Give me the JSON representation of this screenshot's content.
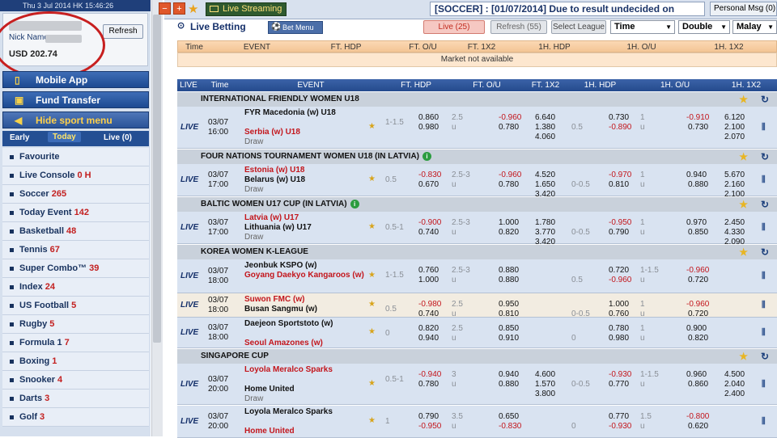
{
  "topbar": {
    "datetime": "Thu 3 Jul 2014  HK 15:46:26"
  },
  "account": {
    "nick_label": "Nick Name",
    "balance": "USD 202.74",
    "refresh": "Refresh"
  },
  "sidebar_buttons": {
    "mobile": "Mobile App",
    "fund": "Fund Transfer",
    "hide": "Hide sport menu"
  },
  "day_tabs": {
    "early": "Early",
    "today": "Today",
    "live": "Live (0)"
  },
  "sports": [
    {
      "name": "Favourite",
      "count": ""
    },
    {
      "name": "Live Console",
      "count": "0 H"
    },
    {
      "name": "Soccer",
      "count": "265"
    },
    {
      "name": "Today Event",
      "count": "142"
    },
    {
      "name": "Basketball",
      "count": "48"
    },
    {
      "name": "Tennis",
      "count": "67"
    },
    {
      "name": "Super Combo™",
      "count": "39"
    },
    {
      "name": "Index",
      "count": "24"
    },
    {
      "name": "US Football",
      "count": "5"
    },
    {
      "name": "Rugby",
      "count": "5"
    },
    {
      "name": "Formula 1",
      "count": "7"
    },
    {
      "name": "Boxing",
      "count": "1"
    },
    {
      "name": "Snooker",
      "count": "4"
    },
    {
      "name": "Darts",
      "count": "3"
    },
    {
      "name": "Golf",
      "count": "3"
    }
  ],
  "toolbar": {
    "live_streaming": "Live Streaming",
    "marquee": "[SOCCER] : [01/07/2014] Due to result undecided on",
    "personal_msg": "Personal Msg (0)"
  },
  "live_betting": {
    "title": "Live Betting",
    "bet_menu": "Bet Menu",
    "live_count": "Live (25)",
    "refresh_count": "Refresh (55)",
    "select_league": "Select League",
    "sort": "Time",
    "odds_type": "Double",
    "odds_format": "Malay"
  },
  "table1": {
    "headers": [
      "Time",
      "EVENT",
      "FT. HDP",
      "FT. O/U",
      "FT. 1X2",
      "1H. HDP",
      "1H. O/U",
      "1H. 1X2"
    ],
    "message": "Market not available"
  },
  "table2_headers": [
    "LIVE",
    "Time",
    "EVENT",
    "FT. HDP",
    "FT. O/U",
    "FT. 1X2",
    "1H. HDP",
    "1H. O/U",
    "1H. 1X2"
  ],
  "leagues": [
    {
      "name": "INTERNATIONAL FRIENDLY WOMEN U18"
    },
    {
      "name": "FOUR NATIONS TOURNAMENT WOMEN U18 (IN LATVIA)"
    },
    {
      "name": "BALTIC WOMEN U17 CUP (IN LATVIA)"
    },
    {
      "name": "KOREA WOMEN K-LEAGUE"
    },
    {
      "name": "SINGAPORE CUP"
    }
  ],
  "matches": [
    {
      "date": "03/07",
      "time": "16:00",
      "home": "FYR Macedonia (w) U18",
      "away": "Serbia (w) U18",
      "draw": "Draw",
      "ft_hdp_line": "1-1.5",
      "ft_hdp_h": "0.860",
      "ft_hdp_a": "0.980",
      "ft_ou_line": "2.5",
      "ft_ou_u": "u",
      "ft_ou_o": "-0.960",
      "ft_ou_u_val": "0.780",
      "ft1x2": [
        "6.640",
        "1.380",
        "4.060"
      ],
      "h1_hdp_line": "0.5",
      "h1_hdp_h": "0.730",
      "h1_hdp_a": "-0.890",
      "h1_ou_line": "1",
      "h1_ou_u": "u",
      "h1_ou_o": "-0.910",
      "h1_ou_u_val": "0.730",
      "h1x2": [
        "6.120",
        "2.100",
        "2.070"
      ]
    },
    {
      "date": "03/07",
      "time": "17:00",
      "home": "Estonia (w) U18",
      "away": "Belarus (w) U18",
      "draw": "Draw",
      "ft_hdp_line": "0.5",
      "ft_hdp_h": "-0.830",
      "ft_hdp_a": "0.670",
      "ft_ou_line": "2.5-3",
      "ft_ou_u": "u",
      "ft_ou_o": "-0.960",
      "ft_ou_u_val": "0.780",
      "ft1x2": [
        "4.520",
        "1.650",
        "3.420"
      ],
      "h1_hdp_line": "0-0.5",
      "h1_hdp_h": "-0.970",
      "h1_hdp_a": "0.810",
      "h1_ou_line": "1",
      "h1_ou_u": "u",
      "h1_ou_o": "0.940",
      "h1_ou_u_val": "0.880",
      "h1x2": [
        "5.670",
        "2.160",
        "2.100"
      ]
    },
    {
      "date": "03/07",
      "time": "17:00",
      "home": "Latvia (w) U17",
      "away": "Lithuania (w) U17",
      "draw": "Draw",
      "ft_hdp_line": "0.5-1",
      "ft_hdp_h": "-0.900",
      "ft_hdp_a": "0.740",
      "ft_ou_line": "2.5-3",
      "ft_ou_u": "u",
      "ft_ou_o": "1.000",
      "ft_ou_u_val": "0.820",
      "ft1x2": [
        "1.780",
        "3.770",
        "3.420"
      ],
      "h1_hdp_line": "0-0.5",
      "h1_hdp_h": "-0.950",
      "h1_hdp_a": "0.790",
      "h1_ou_line": "1",
      "h1_ou_u": "u",
      "h1_ou_o": "0.970",
      "h1_ou_u_val": "0.850",
      "h1x2": [
        "2.450",
        "4.330",
        "2.090"
      ]
    },
    {
      "date": "03/07",
      "time": "18:00",
      "home": "Jeonbuk KSPO (w)",
      "away": "Goyang Daekyo Kangaroos (w)",
      "draw": "",
      "ft_hdp_line": "1-1.5",
      "ft_hdp_h": "0.760",
      "ft_hdp_a": "1.000",
      "ft_ou_line": "2.5-3",
      "ft_ou_u": "u",
      "ft_ou_o": "0.880",
      "ft_ou_u_val": "0.880",
      "ft1x2": [
        "",
        "",
        ""
      ],
      "h1_hdp_line": "0.5",
      "h1_hdp_h": "0.720",
      "h1_hdp_a": "-0.960",
      "h1_ou_line": "1-1.5",
      "h1_ou_u": "u",
      "h1_ou_o": "-0.960",
      "h1_ou_u_val": "0.720",
      "h1x2": [
        "",
        "",
        ""
      ]
    },
    {
      "date": "03/07",
      "time": "18:00",
      "home": "Suwon FMC (w)",
      "away": "Busan Sangmu (w)",
      "draw": "",
      "ft_hdp_line": "0.5",
      "ft_hdp_h": "-0.980",
      "ft_hdp_a": "0.740",
      "ft_ou_line": "2.5",
      "ft_ou_u": "u",
      "ft_ou_o": "0.950",
      "ft_ou_u_val": "0.810",
      "ft1x2": [
        "",
        "",
        ""
      ],
      "h1_hdp_line": "0-0.5",
      "h1_hdp_h": "1.000",
      "h1_hdp_a": "0.760",
      "h1_ou_line": "1",
      "h1_ou_u": "u",
      "h1_ou_o": "-0.960",
      "h1_ou_u_val": "0.720",
      "h1x2": [
        "",
        "",
        ""
      ]
    },
    {
      "date": "03/07",
      "time": "18:00",
      "home": "Daejeon Sportstoto (w)",
      "away": "Seoul Amazones (w)",
      "draw": "",
      "ft_hdp_line": "0",
      "ft_hdp_h": "0.820",
      "ft_hdp_a": "0.940",
      "ft_ou_line": "2.5",
      "ft_ou_u": "u",
      "ft_ou_o": "0.850",
      "ft_ou_u_val": "0.910",
      "ft1x2": [
        "",
        "",
        ""
      ],
      "h1_hdp_line": "0",
      "h1_hdp_h": "0.780",
      "h1_hdp_a": "0.980",
      "h1_ou_line": "1",
      "h1_ou_u": "u",
      "h1_ou_o": "0.900",
      "h1_ou_u_val": "0.820",
      "h1x2": [
        "",
        "",
        ""
      ]
    },
    {
      "date": "03/07",
      "time": "20:00",
      "home": "Loyola Meralco Sparks",
      "away": "Home United",
      "draw": "Draw",
      "ft_hdp_line": "0.5-1",
      "ft_hdp_h": "-0.940",
      "ft_hdp_a": "0.780",
      "ft_ou_line": "3",
      "ft_ou_u": "u",
      "ft_ou_o": "0.940",
      "ft_ou_u_val": "0.880",
      "ft1x2": [
        "4.600",
        "1.570",
        "3.800"
      ],
      "h1_hdp_line": "0-0.5",
      "h1_hdp_h": "-0.930",
      "h1_hdp_a": "0.770",
      "h1_ou_line": "1-1.5",
      "h1_ou_u": "u",
      "h1_ou_o": "0.960",
      "h1_ou_u_val": "0.860",
      "h1x2": [
        "4.500",
        "2.040",
        "2.400"
      ]
    },
    {
      "date": "03/07",
      "time": "20:00",
      "home": "Loyola Meralco Sparks",
      "away": "Home United",
      "draw": "",
      "ft_hdp_line": "1",
      "ft_hdp_h": "0.790",
      "ft_hdp_a": "-0.950",
      "ft_ou_line": "3.5",
      "ft_ou_u": "u",
      "ft_ou_o": "0.650",
      "ft_ou_u_val": "-0.830",
      "ft1x2": [
        "",
        "",
        ""
      ],
      "h1_hdp_line": "0",
      "h1_hdp_h": "0.770",
      "h1_hdp_a": "-0.930",
      "h1_ou_line": "1.5",
      "h1_ou_u": "u",
      "h1_ou_o": "-0.800",
      "h1_ou_u_val": "0.620",
      "h1x2": [
        "",
        "",
        ""
      ]
    }
  ],
  "colors": {
    "nav": "#1f4b91",
    "league_bar": "#c9d1db",
    "row": "#d9e3f1",
    "negative": "#c3161c",
    "ring": "#c71f1f"
  }
}
